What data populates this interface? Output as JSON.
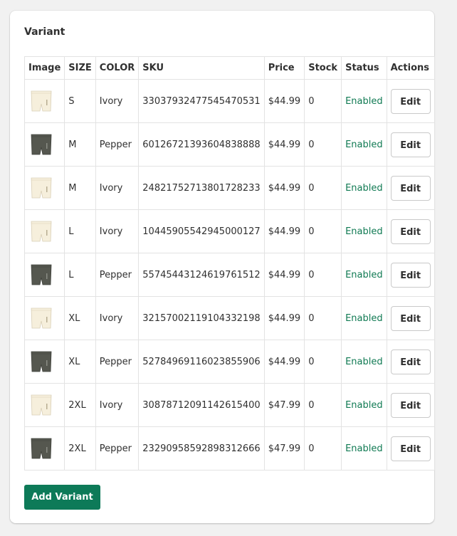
{
  "card": {
    "title": "Variant"
  },
  "table": {
    "headers": {
      "image": "Image",
      "size": "SIZE",
      "color": "COLOR",
      "sku": "SKU",
      "price": "Price",
      "stock": "Stock",
      "status": "Status",
      "actions": "Actions"
    },
    "rows": [
      {
        "size": "S",
        "color": "Ivory",
        "sku": "33037932477545470531",
        "price": "$44.99",
        "stock": "0",
        "status": "Enabled",
        "action": "Edit",
        "swatch": "#f6efdc"
      },
      {
        "size": "M",
        "color": "Pepper",
        "sku": "60126721393604838888",
        "price": "$44.99",
        "stock": "0",
        "status": "Enabled",
        "action": "Edit",
        "swatch": "#55574f"
      },
      {
        "size": "M",
        "color": "Ivory",
        "sku": "24821752713801728233",
        "price": "$44.99",
        "stock": "0",
        "status": "Enabled",
        "action": "Edit",
        "swatch": "#f6efdc"
      },
      {
        "size": "L",
        "color": "Ivory",
        "sku": "10445905542945000127",
        "price": "$44.99",
        "stock": "0",
        "status": "Enabled",
        "action": "Edit",
        "swatch": "#f6efdc"
      },
      {
        "size": "L",
        "color": "Pepper",
        "sku": "55745443124619761512",
        "price": "$44.99",
        "stock": "0",
        "status": "Enabled",
        "action": "Edit",
        "swatch": "#55574f"
      },
      {
        "size": "XL",
        "color": "Ivory",
        "sku": "32157002119104332198",
        "price": "$44.99",
        "stock": "0",
        "status": "Enabled",
        "action": "Edit",
        "swatch": "#f6efdc"
      },
      {
        "size": "XL",
        "color": "Pepper",
        "sku": "52784969116023855906",
        "price": "$44.99",
        "stock": "0",
        "status": "Enabled",
        "action": "Edit",
        "swatch": "#55574f"
      },
      {
        "size": "2XL",
        "color": "Ivory",
        "sku": "30878712091142615400",
        "price": "$47.99",
        "stock": "0",
        "status": "Enabled",
        "action": "Edit",
        "swatch": "#f6efdc"
      },
      {
        "size": "2XL",
        "color": "Pepper",
        "sku": "23290958592898312666",
        "price": "$47.99",
        "stock": "0",
        "status": "Enabled",
        "action": "Edit",
        "swatch": "#55574f"
      }
    ]
  },
  "add_button": {
    "label": "Add Variant"
  },
  "colors": {
    "status_enabled": "#107a53",
    "primary_button": "#0d7a58"
  }
}
